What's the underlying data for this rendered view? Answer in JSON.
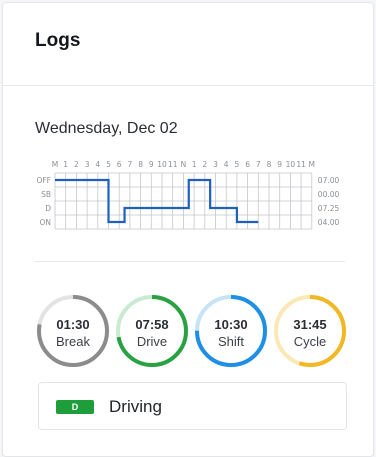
{
  "header": {
    "title": "Logs"
  },
  "log": {
    "date": "Wednesday, Dec 02",
    "hour_labels": [
      "M",
      "1",
      "2",
      "3",
      "4",
      "5",
      "6",
      "7",
      "8",
      "9",
      "10",
      "11",
      "N",
      "1",
      "2",
      "3",
      "4",
      "5",
      "6",
      "7",
      "8",
      "9",
      "10",
      "11",
      "M"
    ],
    "row_labels": [
      "OFF",
      "SB",
      "D",
      "ON"
    ],
    "row_totals": [
      "07.00",
      "00.00",
      "07.25",
      "04.00"
    ],
    "line_color": "#1f5fbf",
    "segments": [
      {
        "status": "OFF",
        "start": 0,
        "end": 5
      },
      {
        "status": "ON",
        "start": 5,
        "end": 6.5
      },
      {
        "status": "D",
        "start": 6.5,
        "end": 12.5
      },
      {
        "status": "OFF",
        "start": 12.5,
        "end": 14.5
      },
      {
        "status": "D",
        "start": 14.5,
        "end": 17
      },
      {
        "status": "ON",
        "start": 17,
        "end": 19
      }
    ]
  },
  "clocks": [
    {
      "time": "01:30",
      "label": "Break",
      "color": "#8c8c8c",
      "track": "#e3e3e3",
      "fraction": 0.78
    },
    {
      "time": "07:58",
      "label": "Drive",
      "color": "#2aa143",
      "track": "#c9ebd1",
      "fraction": 0.72
    },
    {
      "time": "10:30",
      "label": "Shift",
      "color": "#1f8fe5",
      "track": "#c6e3f8",
      "fraction": 0.75
    },
    {
      "time": "31:45",
      "label": "Cycle",
      "color": "#f2b824",
      "track": "#fbe8b4",
      "fraction": 0.55
    }
  ],
  "status": {
    "badge": "D",
    "text": "Driving",
    "color": "#1e9e3a"
  }
}
